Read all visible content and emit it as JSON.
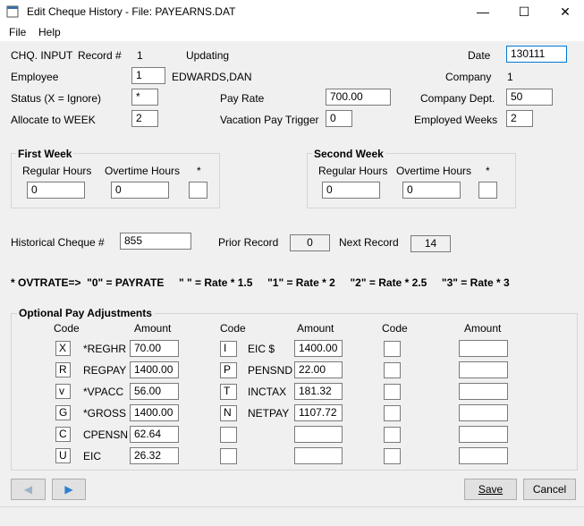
{
  "window": {
    "title": "Edit Cheque History - File: PAYEARNS.DAT",
    "minimize": "—",
    "maximize": "☐",
    "close": "✕"
  },
  "menu": {
    "file": "File",
    "help": "Help"
  },
  "header": {
    "chq_input": "CHQ. INPUT",
    "record_label": "Record #",
    "record_value": "1",
    "mode": "Updating",
    "date_label": "Date",
    "date_value": "130111",
    "employee_label": "Employee",
    "employee_value": "1",
    "employee_name": "EDWARDS,DAN",
    "company_label": "Company",
    "company_value": "1",
    "status_label": "Status (X = Ignore)",
    "status_value": "*",
    "pay_rate_label": "Pay Rate",
    "pay_rate_value": "700.00",
    "company_dept_label": "Company Dept.",
    "company_dept_value": "50",
    "allocate_label": "Allocate to WEEK",
    "allocate_value": "2",
    "vacation_label": "Vacation Pay Trigger",
    "vacation_value": "0",
    "employed_weeks_label": "Employed Weeks",
    "employed_weeks_value": "2"
  },
  "first_week": {
    "title": "First Week",
    "regular_label": "Regular Hours",
    "overtime_label": "Overtime Hours",
    "star_label": "*",
    "regular_value": "0",
    "overtime_value": "0",
    "star_value": ""
  },
  "second_week": {
    "title": "Second Week",
    "regular_label": "Regular Hours",
    "overtime_label": "Overtime Hours",
    "star_label": "*",
    "regular_value": "0",
    "overtime_value": "0",
    "star_value": ""
  },
  "history": {
    "label": "Historical Cheque #",
    "value": "855",
    "prior_label": "Prior Record",
    "prior_value": "0",
    "next_label": "Next Record",
    "next_value": "14"
  },
  "ovtrate_note": "* OVTRATE=>  \"0\" = PAYRATE     \" \" = Rate * 1.5     \"1\" = Rate * 2     \"2\" = Rate * 2.5     \"3\" = Rate * 3",
  "adjustments": {
    "title": "Optional Pay Adjustments",
    "col_code": "Code",
    "col_amount": "Amount",
    "col1": [
      {
        "code": "X",
        "name": "*REGHR",
        "amount": "70.00"
      },
      {
        "code": "R",
        "name": "REGPAY",
        "amount": "1400.00"
      },
      {
        "code": "v",
        "name": "*VPACC",
        "amount": "56.00"
      },
      {
        "code": "G",
        "name": "*GROSS",
        "amount": "1400.00"
      },
      {
        "code": "C",
        "name": "CPENSN",
        "amount": "62.64"
      },
      {
        "code": "U",
        "name": "EIC",
        "amount": "26.32"
      }
    ],
    "col2": [
      {
        "code": "I",
        "name": "EIC $",
        "amount": "1400.00"
      },
      {
        "code": "P",
        "name": "PENSND",
        "amount": "22.00"
      },
      {
        "code": "T",
        "name": "INCTAX",
        "amount": "181.32"
      },
      {
        "code": "N",
        "name": "NETPAY",
        "amount": "1107.72"
      },
      {
        "code": "",
        "name": "",
        "amount": ""
      },
      {
        "code": "",
        "name": "",
        "amount": ""
      }
    ],
    "col3": [
      {
        "code": "",
        "amount": ""
      },
      {
        "code": "",
        "amount": ""
      },
      {
        "code": "",
        "amount": ""
      },
      {
        "code": "",
        "amount": ""
      },
      {
        "code": "",
        "amount": ""
      },
      {
        "code": "",
        "amount": ""
      }
    ]
  },
  "buttons": {
    "save": "Save",
    "cancel": "Cancel",
    "prev": "◀",
    "next": "▶"
  }
}
